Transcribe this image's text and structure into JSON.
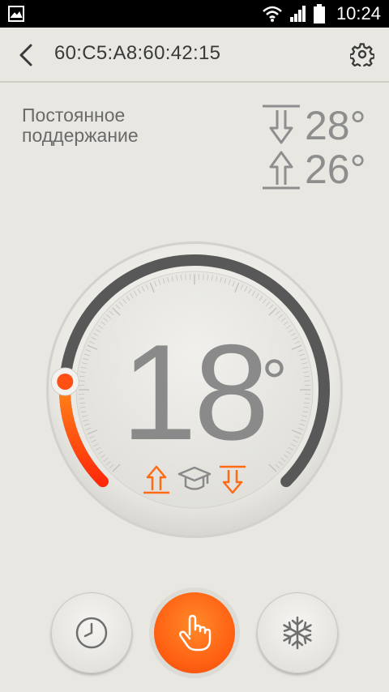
{
  "status_bar": {
    "time": "10:24",
    "icons": [
      "image-icon",
      "wifi-icon",
      "signal-icon",
      "battery-icon"
    ]
  },
  "header": {
    "title": "60:C5:A8:60:42:15",
    "icons": [
      "back-icon",
      "gear-icon"
    ]
  },
  "mode": {
    "label_line1": "Постоянное",
    "label_line2": "поддержание"
  },
  "limits": {
    "upper": "28°",
    "lower": "26°"
  },
  "thermostat": {
    "temperature": "18",
    "degree": "°",
    "level_fraction": 0.18,
    "accent_color": "#ff4a12",
    "track_color": "#585858"
  },
  "bottom_buttons": {
    "items": [
      "clock-icon",
      "hand-icon",
      "snowflake-icon"
    ],
    "active": "hand-icon"
  }
}
